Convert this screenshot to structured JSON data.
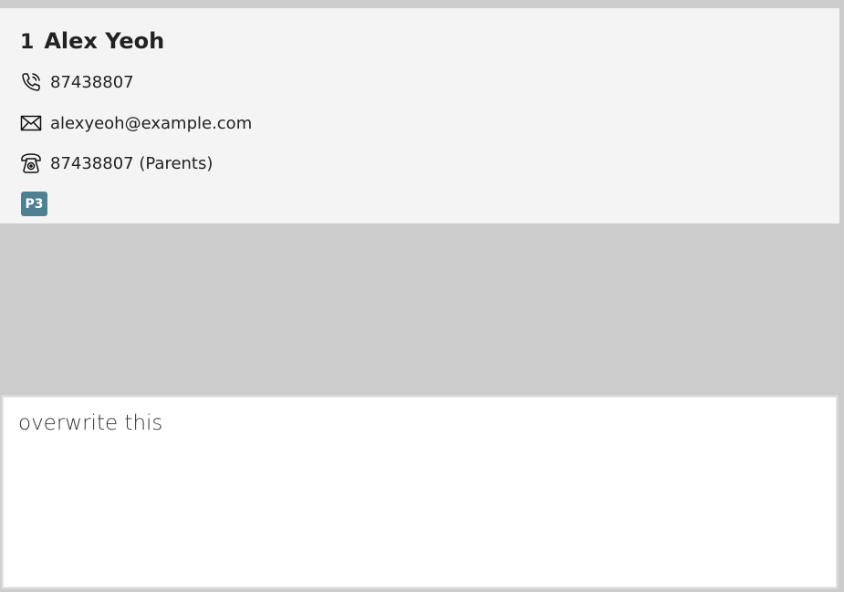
{
  "contact_card": {
    "index": "1",
    "name": "Alex Yeoh",
    "phone": "87438807",
    "email": "alexyeoh@example.com",
    "parent_phone": "87438807 (Parents)",
    "tag": "P3",
    "icons": {
      "phone": "phone-icon",
      "email": "email-icon",
      "parent_phone": "telephone-icon"
    },
    "colors": {
      "card_background": "#f4f4f4",
      "tag_background": "#4e8092",
      "tag_text": "#ffffff"
    }
  },
  "result_display": {
    "text": "overwrite this"
  },
  "colors": {
    "app_background": "#cccccc",
    "result_background": "#ffffff"
  }
}
